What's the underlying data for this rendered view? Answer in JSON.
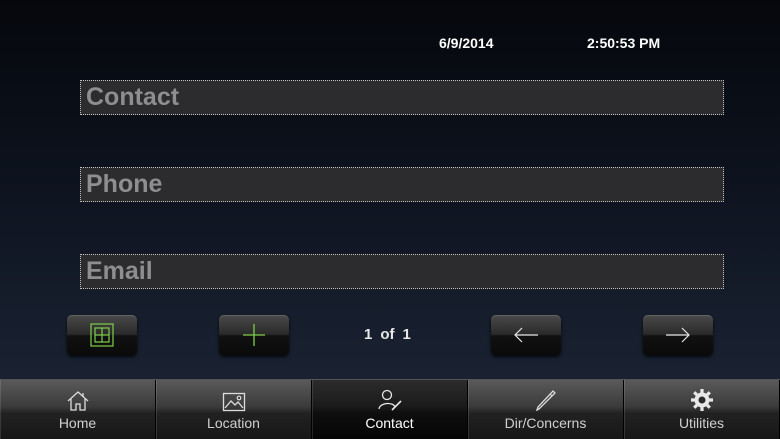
{
  "header": {
    "date": "6/9/2014",
    "time": "2:50:53 PM"
  },
  "form": {
    "contact_placeholder": "Contact",
    "phone_placeholder": "Phone",
    "email_placeholder": "Email"
  },
  "pager": {
    "current": "1",
    "of_label": "of",
    "total": "1"
  },
  "controls": {
    "grid_icon": "grid-square-icon",
    "add_icon": "plus-icon",
    "prev_icon": "arrow-left-icon",
    "next_icon": "arrow-right-icon",
    "accent": "#7fd04a"
  },
  "tabs": [
    {
      "label": "Home",
      "icon": "home-icon"
    },
    {
      "label": "Location",
      "icon": "image-icon"
    },
    {
      "label": "Contact",
      "icon": "contact-edit-icon",
      "active": true
    },
    {
      "label": "Dir/Concerns",
      "icon": "pencil-icon"
    },
    {
      "label": "Utilities",
      "icon": "gear-icon"
    }
  ]
}
